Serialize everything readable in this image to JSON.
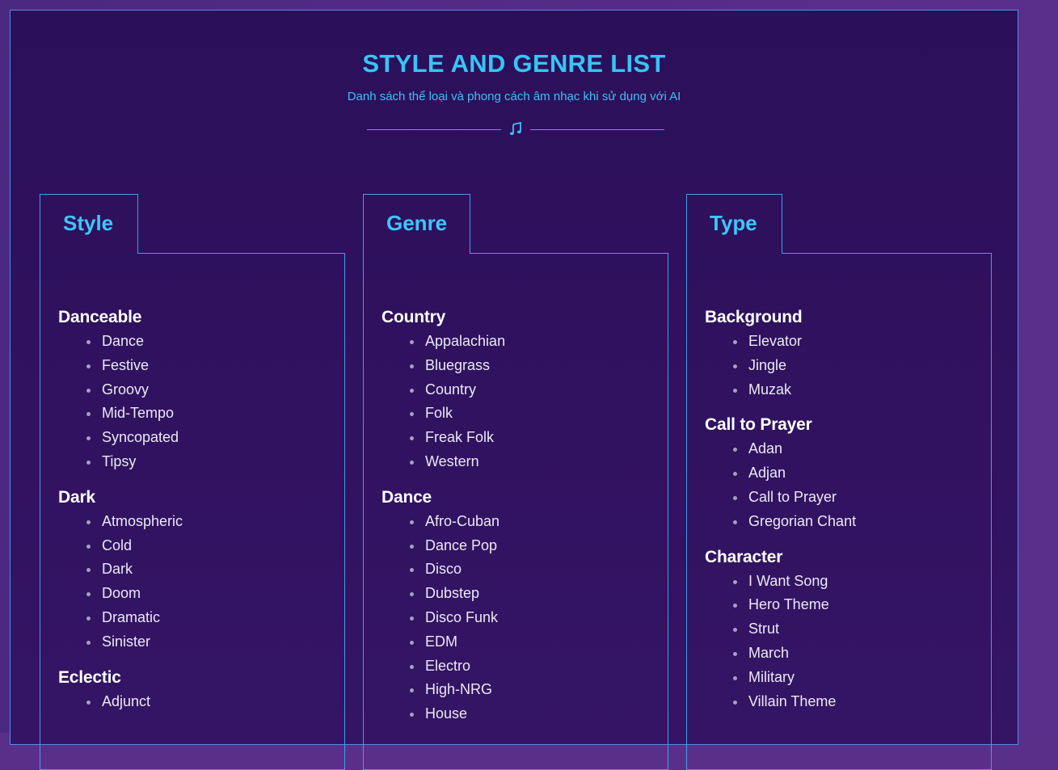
{
  "header": {
    "title": "STYLE AND GENRE LIST",
    "subtitle": "Danh sách thể loại và phong cách âm nhạc khi sử dụng với AI"
  },
  "colors": {
    "accent": "#36c5f5",
    "border": "#3f9fea",
    "background": "#2b0f5a",
    "outer_background": "#5a2f8a"
  },
  "panels": [
    {
      "label": "Style",
      "groups": [
        {
          "title": "Danceable",
          "items": [
            "Dance",
            "Festive",
            "Groovy",
            "Mid-Tempo",
            "Syncopated",
            "Tipsy"
          ]
        },
        {
          "title": "Dark",
          "items": [
            "Atmospheric",
            "Cold",
            "Dark",
            "Doom",
            "Dramatic",
            "Sinister"
          ]
        },
        {
          "title": "Eclectic",
          "items": [
            "Adjunct"
          ]
        }
      ]
    },
    {
      "label": "Genre",
      "groups": [
        {
          "title": "Country",
          "items": [
            "Appalachian",
            "Bluegrass",
            "Country",
            "Folk",
            "Freak Folk",
            "Western"
          ]
        },
        {
          "title": "Dance",
          "items": [
            "Afro-Cuban",
            "Dance Pop",
            "Disco",
            "Dubstep",
            "Disco Funk",
            "EDM",
            "Electro",
            "High-NRG",
            "House"
          ]
        }
      ]
    },
    {
      "label": "Type",
      "groups": [
        {
          "title": "Background",
          "items": [
            "Elevator",
            "Jingle",
            "Muzak"
          ]
        },
        {
          "title": "Call to Prayer",
          "items": [
            "Adan",
            "Adjan",
            "Call to Prayer",
            "Gregorian Chant"
          ]
        },
        {
          "title": "Character",
          "items": [
            "I Want Song",
            "Hero Theme",
            "Strut",
            "March",
            "Military",
            "Villain Theme"
          ]
        }
      ]
    }
  ]
}
